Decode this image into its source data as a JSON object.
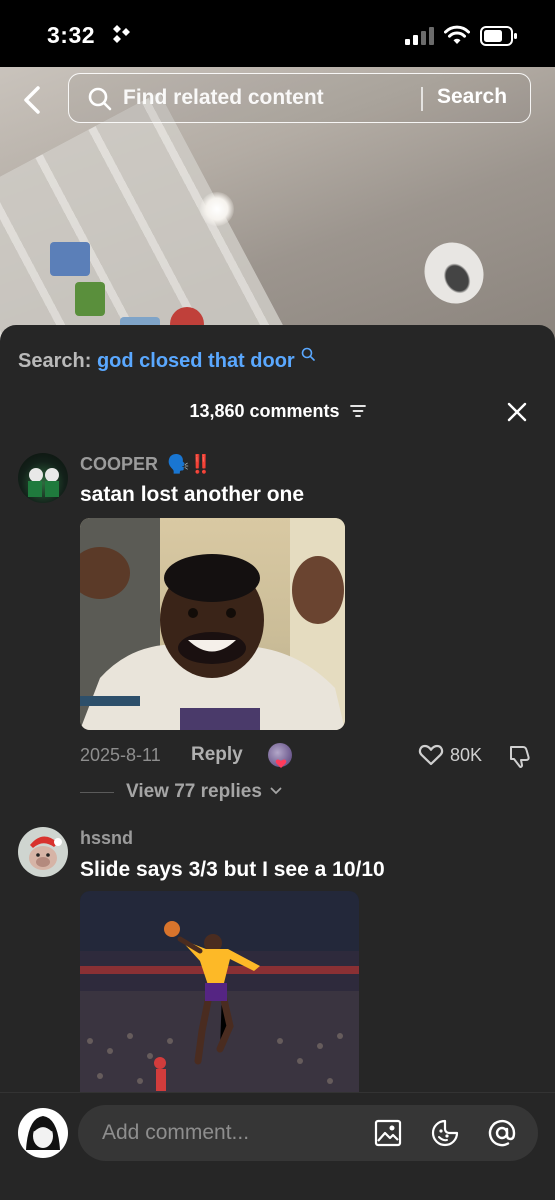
{
  "status": {
    "time": "3:32"
  },
  "search": {
    "placeholder": "Find related content",
    "button_label": "Search"
  },
  "related": {
    "label": "Search:",
    "query": "god closed that door"
  },
  "comments_header": {
    "count_label": "13,860 comments"
  },
  "comments": [
    {
      "username": "COOPER",
      "username_emojis": "🗣️‼️",
      "text": "satan lost another one",
      "date": "2025-8-11",
      "reply_label": "Reply",
      "likes": "80K",
      "view_replies": "View 77 replies"
    },
    {
      "username": "hssnd",
      "text": "Slide says 3/3 but I see a 10/10"
    }
  ],
  "composer": {
    "placeholder": "Add comment..."
  },
  "colors": {
    "accent_link": "#5aa8ff",
    "panel_bg": "#262626",
    "input_bg": "#363636"
  }
}
